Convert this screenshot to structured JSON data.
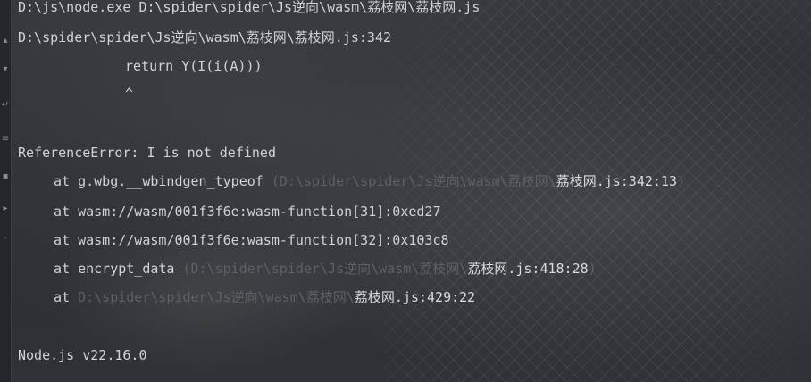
{
  "terminal": {
    "command": "D:\\js\\node.exe D:\\spider\\spider\\Js逆向\\wasm\\荔枝网\\荔枝网.js",
    "error_location": "D:\\spider\\spider\\Js逆向\\wasm\\荔枝网\\荔枝网.js:342",
    "code_line": "return Y(I(i(A)))",
    "caret": "^",
    "error_message": "ReferenceError: I is not defined",
    "stack": [
      {
        "prefix": "at g.wbg.__wbindgen_typeof ",
        "dim": "(D:\\spider\\spider\\Js逆向\\wasm\\荔枝网\\",
        "link": "荔枝网.js:342:13",
        "suffix": ")"
      },
      {
        "prefix": "at wasm://wasm/001f3f6e:wasm-function[31]:0xed27"
      },
      {
        "prefix": "at wasm://wasm/001f3f6e:wasm-function[32]:0x103c8"
      },
      {
        "prefix": "at encrypt_data ",
        "dim": "(D:\\spider\\spider\\Js逆向\\wasm\\荔枝网\\",
        "link": "荔枝网.js:418:28",
        "suffix": ")"
      },
      {
        "prefix": "at ",
        "dim": "D:\\spider\\spider\\Js逆向\\wasm\\荔枝网\\",
        "link": "荔枝网.js:429:22"
      }
    ],
    "node_version": "Node.js v22.16.0"
  },
  "gutter_icons": [
    "up-arrow-icon",
    "down-arrow-icon",
    "wrap-icon",
    "filter-icon",
    "print-icon",
    "delete-icon",
    "pin-icon"
  ],
  "colors": {
    "text": "#d0d3d6",
    "dim_path": "#5e6064",
    "background": "#2b2d30"
  }
}
